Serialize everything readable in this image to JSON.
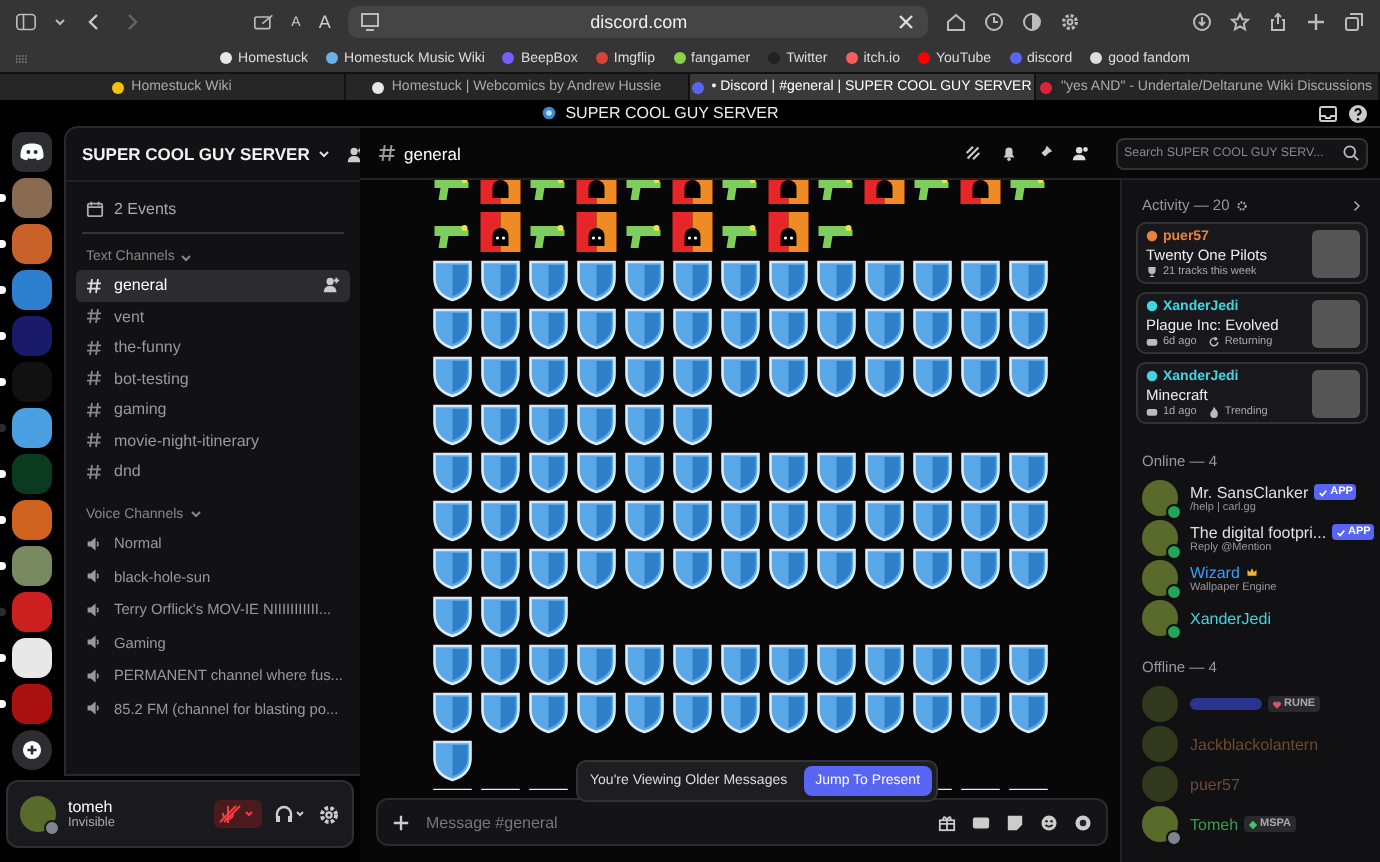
{
  "browser": {
    "url": "discord.com",
    "text_size_buttons": [
      "A",
      "A"
    ],
    "bookmarks": [
      {
        "label": "Homestuck",
        "color": "#e6e6e6"
      },
      {
        "label": "Homestuck Music Wiki",
        "color": "#6ab0e8"
      },
      {
        "label": "BeepBox",
        "color": "#7b5cff"
      },
      {
        "label": "Imgflip",
        "color": "#d6453a"
      },
      {
        "label": "fangamer",
        "color": "#8bd14a"
      },
      {
        "label": "Twitter",
        "color": "#222222"
      },
      {
        "label": "itch.io",
        "color": "#fa5c5c"
      },
      {
        "label": "YouTube",
        "color": "#ff0000"
      },
      {
        "label": "discord",
        "color": "#5865f2"
      },
      {
        "label": "good fandom",
        "color": "#dddddd"
      }
    ],
    "tabs": [
      {
        "label": "Homestuck Wiki",
        "selected": false,
        "color": "#f5c400"
      },
      {
        "label": "Homestuck | Webcomics by Andrew Hussie",
        "selected": false,
        "color": "#e6e6e6"
      },
      {
        "label": "• Discord | #general | SUPER COOL GUY SERVER",
        "selected": true,
        "color": "#5865f2"
      },
      {
        "label": "\"yes AND\" - Undertale/Deltarune Wiki Discussions",
        "selected": false,
        "color": "#e0233a"
      }
    ],
    "window_title": "SUPER COOL GUY SERVER"
  },
  "servers": [
    {
      "color": "#8a6a50",
      "unread": true
    },
    {
      "color": "#c8622a",
      "unread": true
    },
    {
      "color": "#2d7fd0",
      "unread": true
    },
    {
      "color": "#1a1a6a",
      "unread": true
    },
    {
      "color": "#111111",
      "unread": true
    },
    {
      "color": "#4aa0e0",
      "unread": false
    },
    {
      "color": "#0a3a20",
      "unread": true
    },
    {
      "color": "#d0641e",
      "unread": true
    },
    {
      "color": "#7a8a60",
      "unread": true
    },
    {
      "color": "#cc2020",
      "unread": false
    },
    {
      "color": "#e8e8e8",
      "unread": true
    },
    {
      "color": "#aa1010",
      "unread": true
    }
  ],
  "server": {
    "name": "SUPER COOL GUY SERVER",
    "events": "2 Events",
    "text_header": "Text Channels",
    "text_channels": [
      {
        "name": "general",
        "selected": true
      },
      {
        "name": "vent",
        "selected": false
      },
      {
        "name": "the-funny",
        "selected": false
      },
      {
        "name": "bot-testing",
        "selected": false
      },
      {
        "name": "gaming",
        "selected": false
      },
      {
        "name": "movie-night-itinerary",
        "selected": false
      },
      {
        "name": "dnd",
        "selected": false
      }
    ],
    "voice_header": "Voice Channels",
    "voice_channels": [
      "Normal",
      "black-hole-sun",
      "Terry Orflick's MOV-IE NIIIIIIIIIII...",
      "Gaming",
      "PERMANENT channel where fus...",
      "85.2 FM (channel for blasting po..."
    ]
  },
  "user": {
    "name": "tomeh",
    "status": "Invisible",
    "muted": true
  },
  "chat": {
    "channel": "general",
    "search_placeholder": "Search SUPER COOL GUY SERV...",
    "older_notice": "You're Viewing Older Messages",
    "jump_button": "Jump To Present",
    "input_placeholder": "Message #general"
  },
  "members": {
    "activity_header": "Activity — 20",
    "activities": [
      {
        "user": "puer57",
        "color": "#e8823a",
        "title": "Twenty One Pilots",
        "details": [
          {
            "kind": "trophy",
            "text": "21 tracks this week"
          }
        ]
      },
      {
        "user": "XanderJedi",
        "color": "#3fd6e0",
        "title": "Plague Inc: Evolved",
        "details": [
          {
            "kind": "gamepad",
            "text": "6d ago"
          },
          {
            "kind": "returning",
            "text": "Returning"
          }
        ]
      },
      {
        "user": "XanderJedi",
        "color": "#3fd6e0",
        "title": "Minecraft",
        "details": [
          {
            "kind": "gamepad",
            "text": "1d ago"
          },
          {
            "kind": "trending",
            "text": "Trending"
          }
        ]
      }
    ],
    "online_header": "Online — 4",
    "online": [
      {
        "name": "Mr. SansClanker",
        "color": "#dfe0e2",
        "kind": "online",
        "subtitle": "/help | carl.gg",
        "badge": {
          "kind": "app",
          "text": "APP"
        }
      },
      {
        "name": "The digital footpri...",
        "color": "#dfe0e2",
        "kind": "online",
        "subtitle": "Reply @Mention",
        "badge": {
          "kind": "app",
          "text": "APP"
        }
      },
      {
        "name": "Wizard",
        "color": "#3a9cff",
        "kind": "online",
        "subtitle": "Wallpaper Engine",
        "crown": true
      },
      {
        "name": "XanderJedi",
        "color": "#3fd6e0",
        "kind": "online"
      }
    ],
    "offline_header": "Offline — 4",
    "offline": [
      {
        "color": "#2a3490",
        "kind": "offline",
        "badge": {
          "kind": "heart",
          "text": "RUNE"
        }
      },
      {
        "name": "Jackblackolantern",
        "color": "#6e4a2a",
        "kind": "offline"
      },
      {
        "name": "puer57",
        "color": "#6b4838",
        "kind": "offline"
      },
      {
        "name": "Tomeh",
        "color": "#3c9a4e",
        "kind": "invisible",
        "badge": {
          "kind": "gem",
          "text": "MSPA"
        }
      }
    ]
  }
}
